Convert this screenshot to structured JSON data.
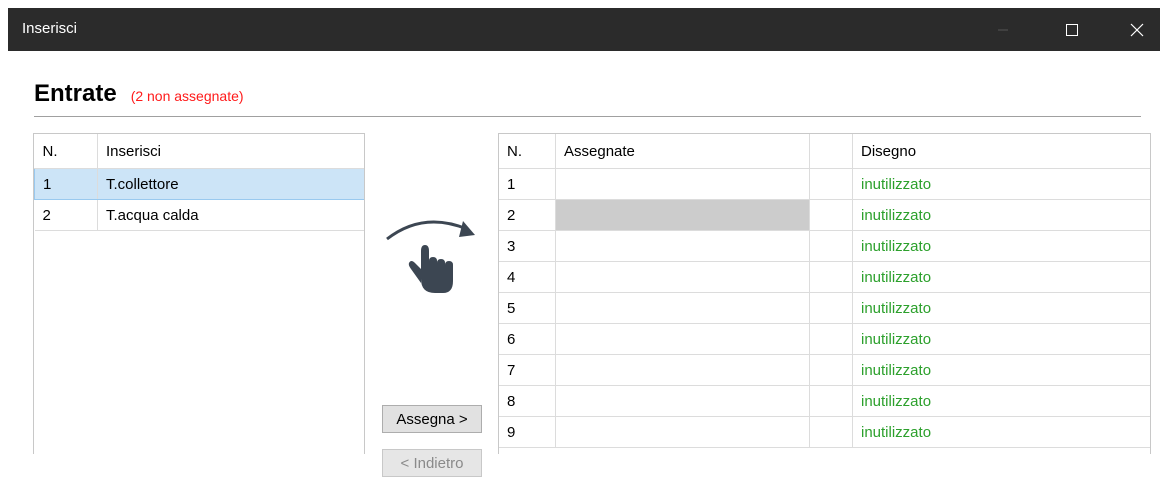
{
  "window": {
    "title": "Inserisci",
    "buttons": [
      "minimize",
      "maximize",
      "close"
    ]
  },
  "header": {
    "title": "Entrate",
    "subtitle": "(2 non assegnate)",
    "subtitle_color": "#ff1a1a"
  },
  "inputs_table": {
    "columns": [
      "N.",
      "Inserisci"
    ],
    "rows": [
      {
        "n": "1",
        "name": "T.collettore",
        "selected": true
      },
      {
        "n": "2",
        "name": "T.acqua calda",
        "selected": false
      }
    ]
  },
  "actions": {
    "assign_label": "Assegna >",
    "back_label": "< Indietro",
    "hand_icon": "drag-hand-icon"
  },
  "assign_table": {
    "columns": [
      "N.",
      "Assegnate",
      "",
      "Disegno"
    ],
    "rows": [
      {
        "n": "1",
        "assigned": "",
        "drawing": "inutilizzato"
      },
      {
        "n": "2",
        "assigned": "",
        "drawing": "inutilizzato"
      },
      {
        "n": "3",
        "assigned": "",
        "drawing": "inutilizzato"
      },
      {
        "n": "4",
        "assigned": "",
        "drawing": "inutilizzato"
      },
      {
        "n": "5",
        "assigned": "",
        "drawing": "inutilizzato"
      },
      {
        "n": "6",
        "assigned": "",
        "drawing": "inutilizzato"
      },
      {
        "n": "7",
        "assigned": "",
        "drawing": "inutilizzato"
      },
      {
        "n": "8",
        "assigned": "",
        "drawing": "inutilizzato"
      },
      {
        "n": "9",
        "assigned": "",
        "drawing": "inutilizzato"
      }
    ],
    "drawing_color": "#2ca02c"
  }
}
